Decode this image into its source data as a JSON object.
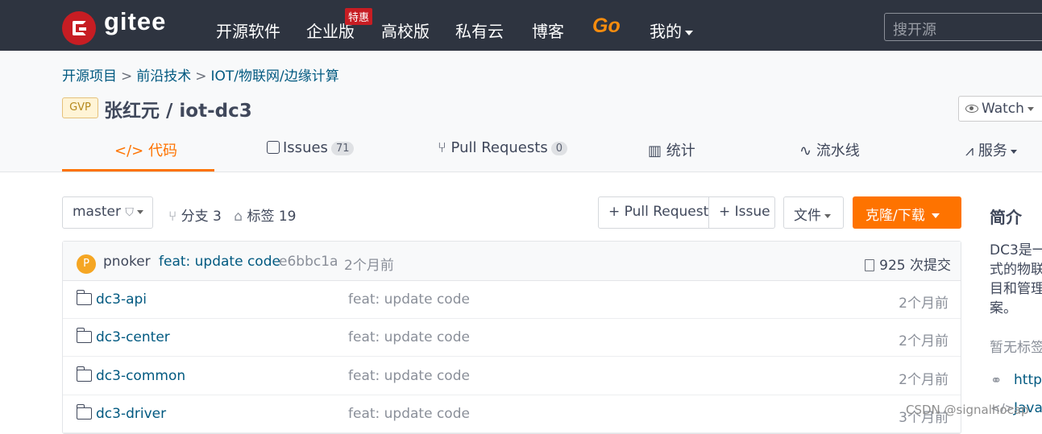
{
  "topnav": {
    "logo_text": "gitee",
    "items": [
      "开源软件",
      "企业版",
      "高校版",
      "私有云",
      "博客"
    ],
    "badge": "特惠",
    "go": "Go",
    "mine": "我的",
    "search_placeholder": "搜开源"
  },
  "breadcrumb": [
    "开源项目",
    "前沿技术",
    "IOT/物联网/边缘计算"
  ],
  "repo": {
    "gvp": "GVP",
    "title": "张红元 / iot-dc3",
    "watch": "Watch"
  },
  "tabs": [
    {
      "label": "代码",
      "icon": "code-icon"
    },
    {
      "label": "Issues",
      "count": "71"
    },
    {
      "label": "Pull Requests",
      "count": "0"
    },
    {
      "label": "统计"
    },
    {
      "label": "流水线"
    },
    {
      "label": "服务"
    }
  ],
  "toolbar": {
    "branch": "master",
    "branches": "分支 3",
    "tags": "标签 19",
    "pull_request": "+ Pull Request",
    "issue": "+ Issue",
    "file": "文件",
    "clone": "克隆/下载"
  },
  "commit": {
    "avatar_letter": "P",
    "user": "pnoker",
    "message": "feat: update code",
    "hash": "e6bbc1a",
    "time": "2个月前",
    "count": "925 次提交"
  },
  "files": [
    {
      "name": "dc3-api",
      "message": "feat: update code",
      "time": "2个月前"
    },
    {
      "name": "dc3-center",
      "message": "feat: update code",
      "time": "2个月前"
    },
    {
      "name": "dc3-common",
      "message": "feat: update code",
      "time": "2个月前"
    },
    {
      "name": "dc3-driver",
      "message": "feat: update code",
      "time": "3个月前"
    }
  ],
  "sidebar": {
    "title": "简介",
    "desc": "DC3是一\n式的物联\n目和管理\n案。",
    "no_tags": "暂无标签",
    "link1": "https",
    "link2": "Java"
  },
  "watermark": "CSDN @signalhocap",
  "colors": {
    "nav_bg": "#2e3440",
    "accent": "#fe7300",
    "link": "#005980"
  }
}
